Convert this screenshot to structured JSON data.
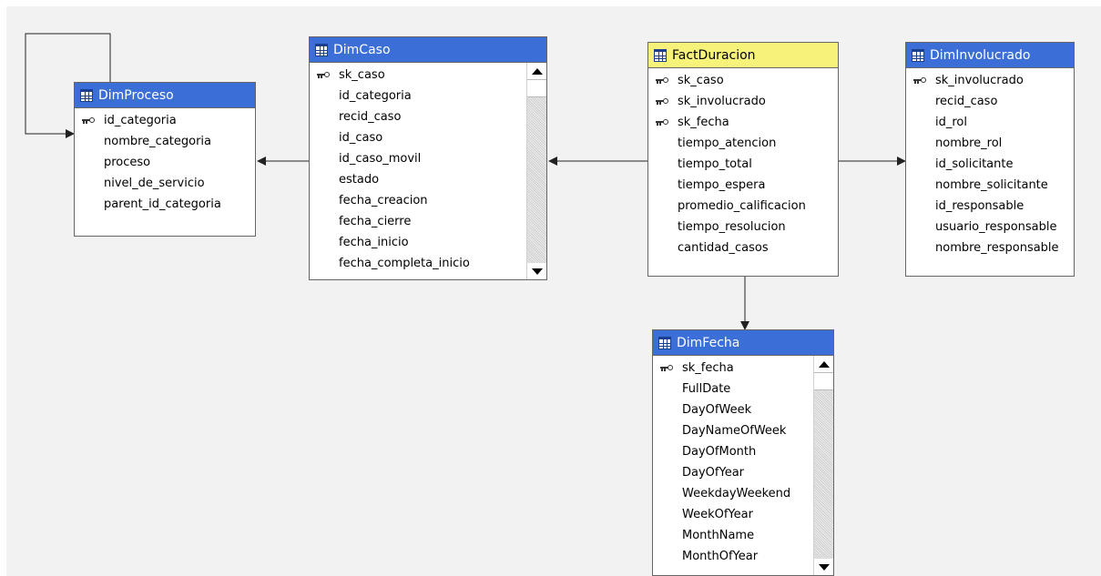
{
  "tables": {
    "dimproceso": {
      "title": "DimProceso",
      "fields": [
        {
          "name": "id_categoria",
          "key": true
        },
        {
          "name": "nombre_categoria",
          "key": false
        },
        {
          "name": "proceso",
          "key": false
        },
        {
          "name": "nivel_de_servicio",
          "key": false
        },
        {
          "name": "parent_id_categoria",
          "key": false
        }
      ]
    },
    "dimcaso": {
      "title": "DimCaso",
      "fields": [
        {
          "name": "sk_caso",
          "key": true
        },
        {
          "name": "id_categoria",
          "key": false
        },
        {
          "name": "recid_caso",
          "key": false
        },
        {
          "name": "id_caso",
          "key": false
        },
        {
          "name": "id_caso_movil",
          "key": false
        },
        {
          "name": "estado",
          "key": false
        },
        {
          "name": "fecha_creacion",
          "key": false
        },
        {
          "name": "fecha_cierre",
          "key": false
        },
        {
          "name": "fecha_inicio",
          "key": false
        },
        {
          "name": "fecha_completa_inicio",
          "key": false
        }
      ]
    },
    "factduracion": {
      "title": "FactDuracion",
      "fields": [
        {
          "name": "sk_caso",
          "key": true
        },
        {
          "name": "sk_involucrado",
          "key": true
        },
        {
          "name": "sk_fecha",
          "key": true
        },
        {
          "name": "tiempo_atencion",
          "key": false
        },
        {
          "name": "tiempo_total",
          "key": false
        },
        {
          "name": "tiempo_espera",
          "key": false
        },
        {
          "name": "promedio_calificacion",
          "key": false
        },
        {
          "name": "tiempo_resolucion",
          "key": false
        },
        {
          "name": "cantidad_casos",
          "key": false
        }
      ]
    },
    "diminvolucrado": {
      "title": "DimInvolucrado",
      "fields": [
        {
          "name": "sk_involucrado",
          "key": true
        },
        {
          "name": "recid_caso",
          "key": false
        },
        {
          "name": "id_rol",
          "key": false
        },
        {
          "name": "nombre_rol",
          "key": false
        },
        {
          "name": "id_solicitante",
          "key": false
        },
        {
          "name": "nombre_solicitante",
          "key": false
        },
        {
          "name": "id_responsable",
          "key": false
        },
        {
          "name": "usuario_responsable",
          "key": false
        },
        {
          "name": "nombre_responsable",
          "key": false
        }
      ]
    },
    "dimfecha": {
      "title": "DimFecha",
      "fields": [
        {
          "name": "sk_fecha",
          "key": true
        },
        {
          "name": "FullDate",
          "key": false
        },
        {
          "name": "DayOfWeek",
          "key": false
        },
        {
          "name": "DayNameOfWeek",
          "key": false
        },
        {
          "name": "DayOfMonth",
          "key": false
        },
        {
          "name": "DayOfYear",
          "key": false
        },
        {
          "name": "WeekdayWeekend",
          "key": false
        },
        {
          "name": "WeekOfYear",
          "key": false
        },
        {
          "name": "MonthName",
          "key": false
        },
        {
          "name": "MonthOfYear",
          "key": false
        }
      ]
    }
  },
  "colors": {
    "header_blue": "#3b6fd7",
    "header_fact": "#f7f27a",
    "canvas": "#f2f2f2"
  },
  "icons": {
    "table": "table-grid-icon",
    "key": "primary-key-icon",
    "scroll_up": "scroll-up-arrow-icon",
    "scroll_down": "scroll-down-arrow-icon"
  }
}
